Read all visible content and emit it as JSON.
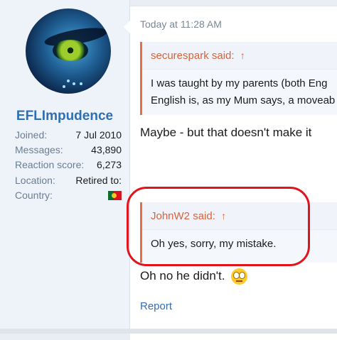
{
  "author": {
    "username": "EFLImpudence",
    "stats": [
      {
        "label": "Joined:",
        "value": "7 Jul 2010"
      },
      {
        "label": "Messages:",
        "value": "43,890"
      },
      {
        "label": "Reaction score:",
        "value": "6,273"
      },
      {
        "label": "Location:",
        "value": "Retired to:"
      },
      {
        "label": "Country:",
        "value": ""
      }
    ]
  },
  "post": {
    "timestamp": "Today at 11:28 AM",
    "quote1": {
      "author": "securespark said:",
      "line1": "I was taught by my parents (both Eng",
      "line2": "English is, as my Mum says, a moveab"
    },
    "message1": "Maybe - but that doesn't make it",
    "quote2": {
      "author": "JohnW2 said:",
      "line1": "Oh yes, sorry, my mistake."
    },
    "message2": "Oh no he didn't.",
    "report_label": "Report"
  },
  "icons": {
    "quote_link": "↑",
    "flag": "portugal-flag",
    "emoji": "rolling-eyes-emoji"
  },
  "colors": {
    "username": "#2f6fb3",
    "quote_author": "#d9623a",
    "highlight": "#e2131b",
    "link": "#2f6fb3"
  }
}
